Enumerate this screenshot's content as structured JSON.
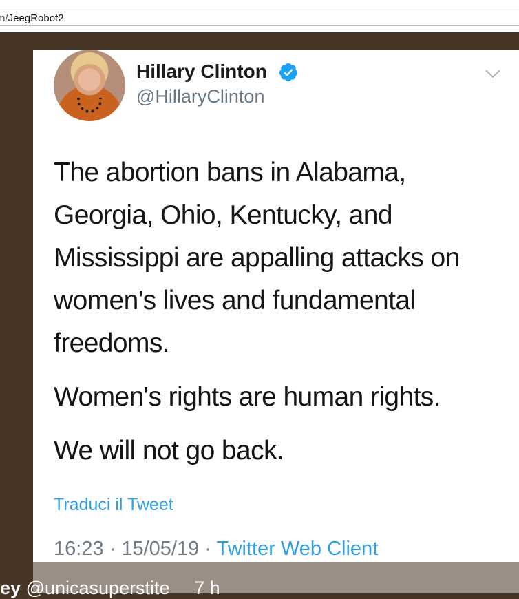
{
  "browser": {
    "url_prefix": "m/",
    "url_path": "JeegRobot2"
  },
  "tweet": {
    "author_name": "Hillary Clinton",
    "author_handle": "@HillaryClinton",
    "paragraphs": [
      "The abortion bans in Alabama, Georgia, Ohio, Kentucky, and Mississippi are appalling attacks on women's lives and fundamental freedoms.",
      "Women's rights are human rights.",
      "We will not go back."
    ],
    "translate_label": "Traduci il Tweet",
    "timestamp": "16:23 · 15/05/19 · ",
    "client": "Twitter Web Client",
    "accent_color": "#1da1f2"
  },
  "bottom": {
    "user_fragment": "ey",
    "handle": "@unicasuperstite",
    "time": "7 h"
  }
}
